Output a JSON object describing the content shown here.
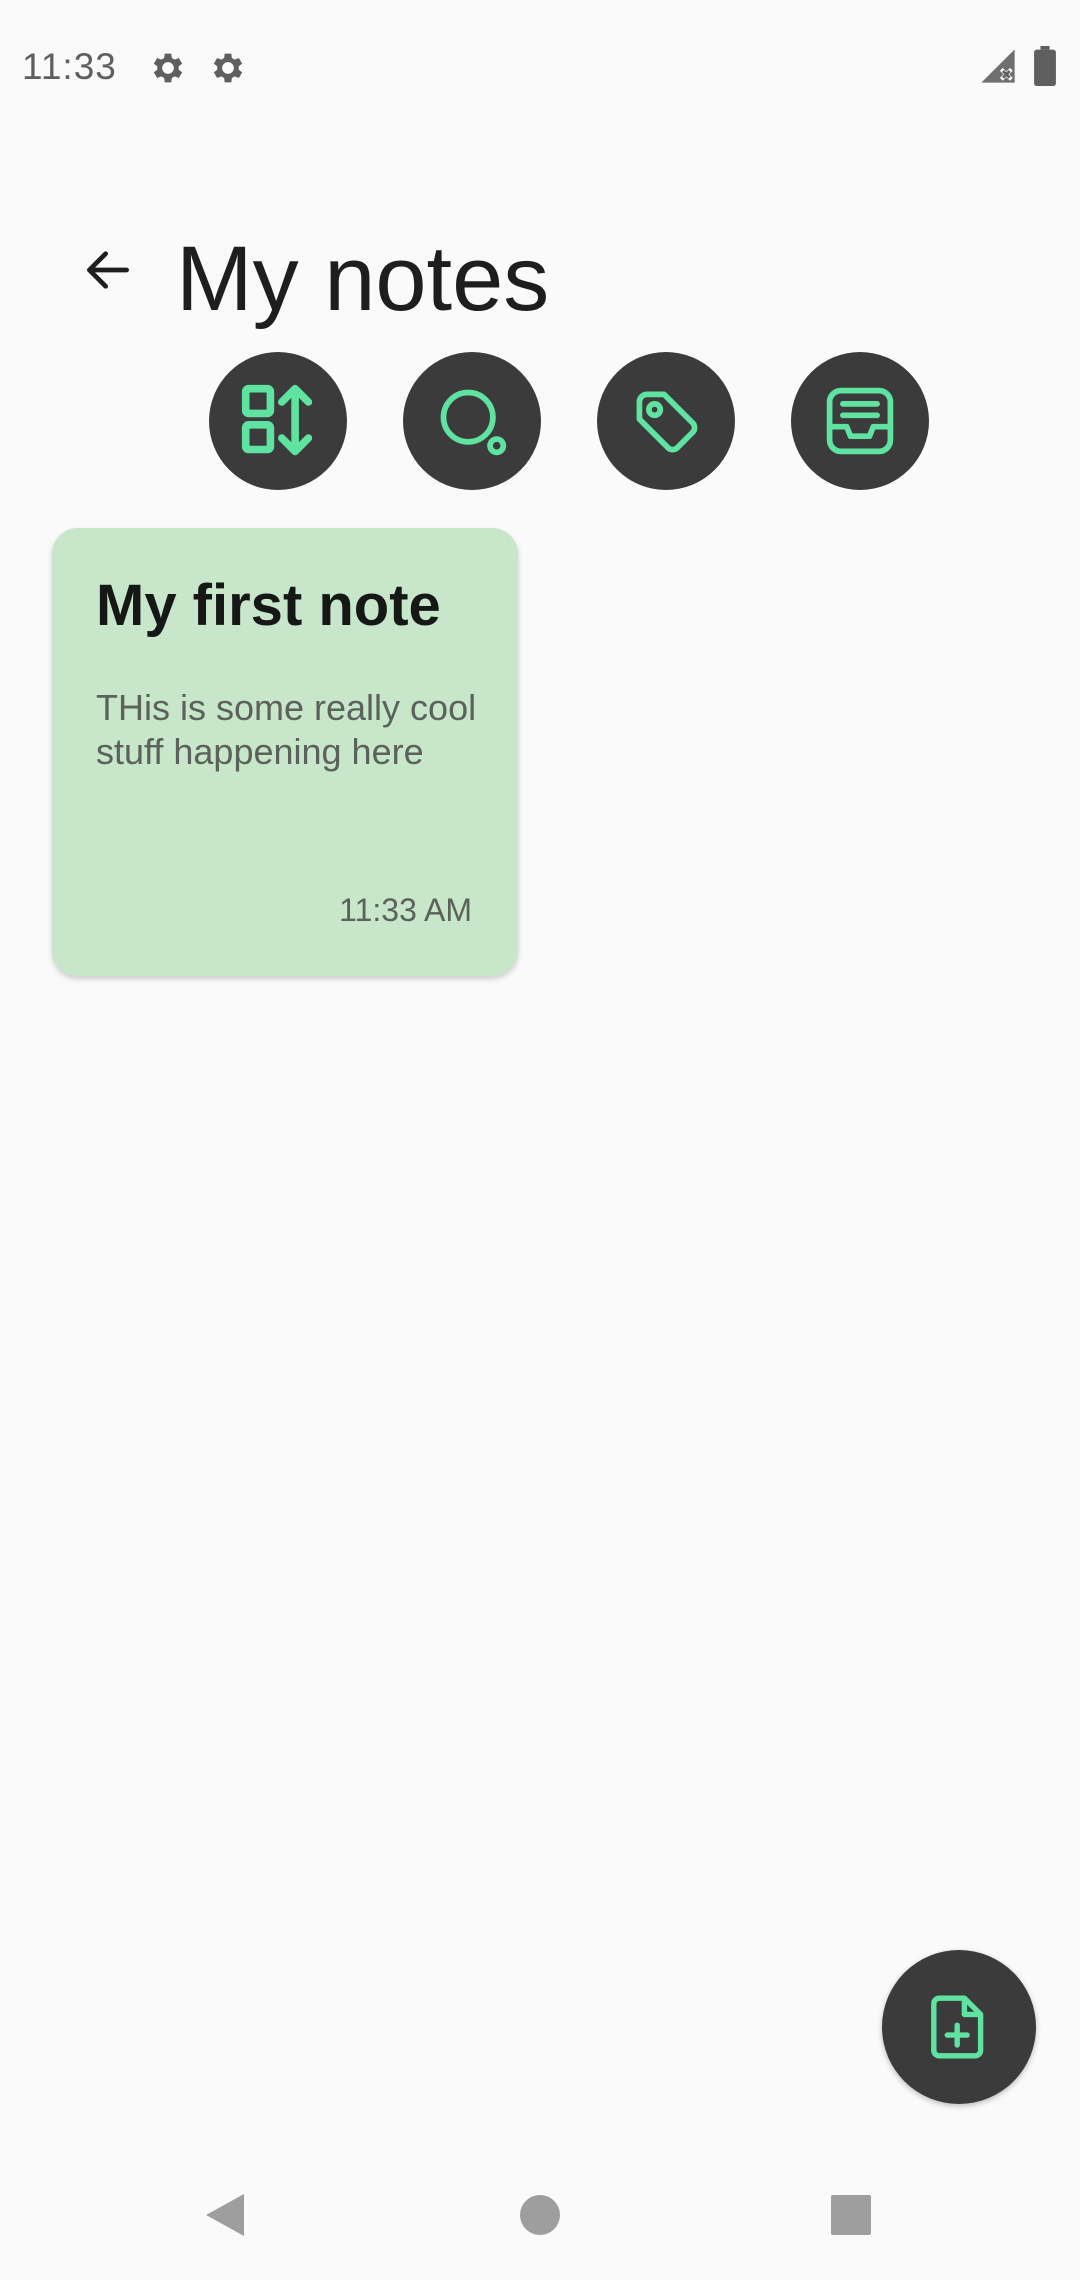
{
  "status_bar": {
    "time": "11:33",
    "left_icons": [
      "settings-icon",
      "settings-icon"
    ],
    "right_icons": [
      "signal-icon",
      "battery-icon"
    ]
  },
  "header": {
    "title": "My notes",
    "back_icon": "arrow-left-icon"
  },
  "toolbar": {
    "buttons": [
      {
        "name": "sort",
        "icon": "sort-layout-icon"
      },
      {
        "name": "search",
        "icon": "search-icon"
      },
      {
        "name": "tags",
        "icon": "tag-icon"
      },
      {
        "name": "archive",
        "icon": "archive-icon"
      }
    ]
  },
  "notes": [
    {
      "title": "My first note",
      "body": "THis is some really cool stuff happening here",
      "time": "11:33 AM",
      "color": "#c8e6c9"
    }
  ],
  "fab": {
    "icon": "new-note-icon"
  },
  "nav_bar": {
    "icons": [
      "back-triangle-icon",
      "home-circle-icon",
      "recents-square-icon"
    ]
  },
  "colors": {
    "accent": "#5fe3a1",
    "button_bg": "#3b3b3b",
    "background": "#fafafa",
    "card": "#c8e6c9"
  }
}
